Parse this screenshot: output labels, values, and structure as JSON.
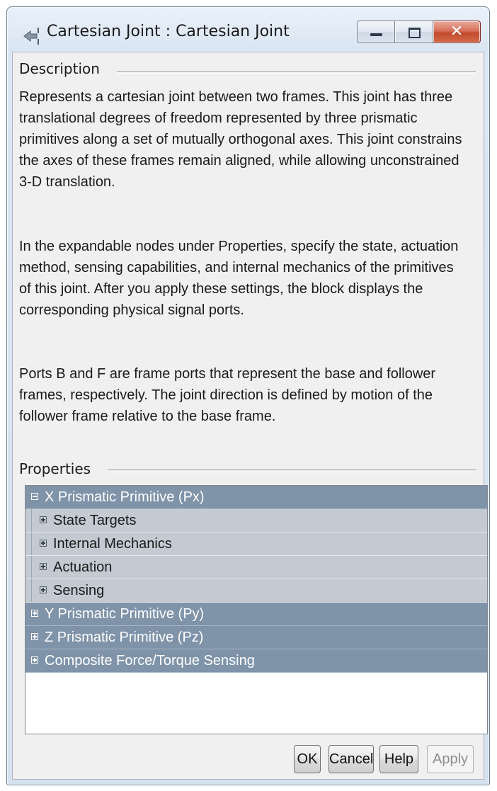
{
  "window": {
    "title": "Cartesian Joint : Cartesian Joint",
    "title_icon": "joint-arrow-icon",
    "controls": {
      "minimize": "minimize-icon",
      "maximize": "maximize-icon",
      "close_glyph": "✕"
    }
  },
  "description": {
    "label": "Description",
    "paragraphs": [
      "Represents a cartesian joint between two frames. This joint has three translational degrees of freedom represented by three prismatic primitives along a set of mutually orthogonal axes. This joint constrains the axes of these frames remain aligned, while allowing unconstrained 3-D translation.",
      "In the expandable nodes under Properties, specify the state, actuation method, sensing capabilities, and internal mechanics of the primitives of this joint. After you apply these settings, the block displays the corresponding physical signal ports.",
      "Ports B and F are frame ports that represent the base and follower frames, respectively. The joint direction is defined by motion of the follower frame relative to the base frame."
    ]
  },
  "properties": {
    "label": "Properties",
    "tree": [
      {
        "label": "X Prismatic Primitive (Px)",
        "level": 0,
        "expanded": true
      },
      {
        "label": "State Targets",
        "level": 1,
        "expanded": false
      },
      {
        "label": "Internal Mechanics",
        "level": 1,
        "expanded": false
      },
      {
        "label": "Actuation",
        "level": 1,
        "expanded": false
      },
      {
        "label": "Sensing",
        "level": 1,
        "expanded": false
      },
      {
        "label": "Y Prismatic Primitive (Py)",
        "level": 0,
        "expanded": false
      },
      {
        "label": "Z Prismatic Primitive (Pz)",
        "level": 0,
        "expanded": false
      },
      {
        "label": "Composite Force/Torque Sensing",
        "level": 0,
        "expanded": false
      }
    ]
  },
  "buttons": {
    "ok": "OK",
    "cancel": "Cancel",
    "help": "Help",
    "apply": "Apply"
  },
  "colors": {
    "tree_top_row": "#7f93a9",
    "tree_sub_row": "#c3cad2",
    "dialog_bg": "#f0f0f0",
    "close_button": "#c24a2e"
  }
}
